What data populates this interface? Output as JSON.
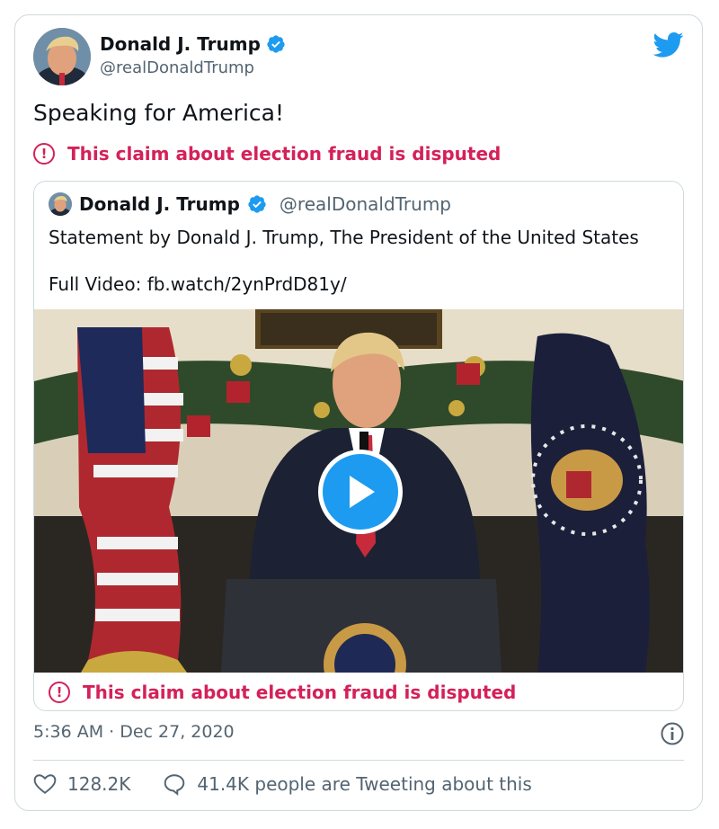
{
  "tweet": {
    "author_name": "Donald J. Trump",
    "author_handle": "@realDonaldTrump",
    "text": "Speaking for America!",
    "dispute_label": "This claim about election fraud is disputed",
    "timestamp": "5:36 AM · Dec 27, 2020"
  },
  "quoted": {
    "author_name": "Donald J. Trump",
    "author_handle": "@realDonaldTrump",
    "line1": "Statement by Donald J. Trump, The President of the United States",
    "line2": "Full Video: fb.watch/2ynPrdD81y/",
    "dispute_label": "This claim about election fraud is disputed"
  },
  "stats": {
    "likes": "128.2K",
    "tweeting": "41.4K people are Tweeting about this"
  },
  "colors": {
    "twitter_blue": "#1d9bf0",
    "dispute_red": "#d4215a",
    "muted": "#536471",
    "border": "#cfd9de"
  },
  "icons": [
    "verified-badge-icon",
    "twitter-bird-icon",
    "dispute-alert-icon",
    "play-icon",
    "info-icon",
    "heart-icon",
    "comment-bubble-icon"
  ]
}
